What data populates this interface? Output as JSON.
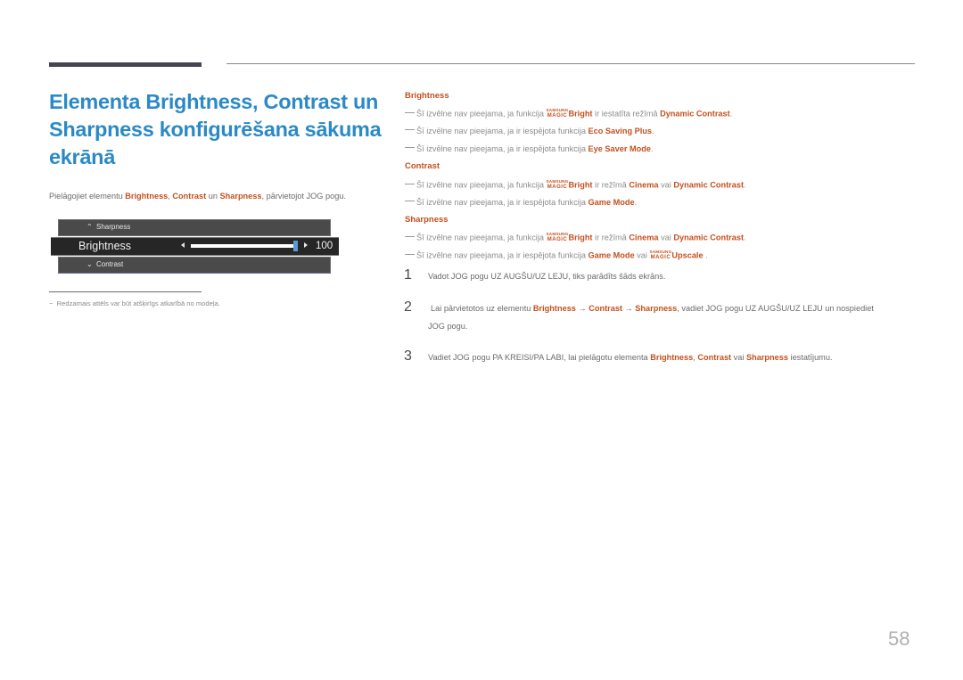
{
  "page": {
    "title": "Elementa Brightness, Contrast un Sharpness konfigurēšana sākuma ekrānā",
    "page_number": "58"
  },
  "intro": {
    "pre": "Pielāgojiet elementu ",
    "b1": "Brightness",
    "sep1": ", ",
    "b2": "Contrast",
    "sep2": " un ",
    "b3": "Sharpness",
    "post": ", pārvietojot JOG pogu."
  },
  "osd": {
    "up_item": "Sharpness",
    "current_item": "Brightness",
    "down_item": "Contrast",
    "value": "100",
    "level_percent": 100,
    "up_chevron_icon": "^",
    "down_chevron_icon": "⌄"
  },
  "footnote": {
    "dash": "−",
    "text": "Redzamais attēls var būt atšķirīgs atkarībā no modeļa."
  },
  "magic_logo": {
    "line1": "SAMSUNG",
    "line2": "MAGIC"
  },
  "sections": {
    "brightness": {
      "heading": "Brightness",
      "notes": [
        {
          "pre": "Šī izvēlne nav pieejama, ja funkcija ",
          "magic": "Bright",
          "mid": " ir iestatīta režīmā ",
          "hl": "Dynamic Contrast",
          "post": "."
        },
        {
          "pre": "Šī izvēlne nav pieejama, ja ir iespējota funkcija ",
          "hl": "Eco Saving Plus",
          "post": "."
        },
        {
          "pre": "Šī izvēlne nav pieejama, ja ir iespējota funkcija ",
          "hl": "Eye Saver Mode",
          "post": "."
        }
      ]
    },
    "contrast": {
      "heading": "Contrast",
      "notes": [
        {
          "pre": "Šī izvēlne nav pieejama, ja funkcija ",
          "magic": "Bright",
          "mid": " ir režīmā ",
          "hl": "Cinema",
          "mid2": " vai ",
          "hl2": "Dynamic Contrast",
          "post": "."
        },
        {
          "pre": "Šī izvēlne nav pieejama, ja ir iespējota funkcija ",
          "hl": "Game Mode",
          "post": "."
        }
      ]
    },
    "sharpness": {
      "heading": "Sharpness",
      "notes": [
        {
          "pre": "Šī izvēlne nav pieejama, ja funkcija ",
          "magic": "Bright",
          "mid": " ir režīmā ",
          "hl": "Cinema",
          "mid2": " vai ",
          "hl2": "Dynamic Contrast",
          "post": "."
        },
        {
          "pre": "Šī izvēlne nav pieejama, ja ir iespējota funkcija ",
          "hl": "Game Mode",
          "mid": " vai ",
          "magic": "Upscale",
          "post": " ."
        }
      ]
    }
  },
  "steps": [
    {
      "num": "1",
      "text": "Vadot JOG pogu UZ AUGŠU/UZ LEJU, tiks parādīts šāds ekrāns."
    },
    {
      "num": "2",
      "pre": "Lai pārvietotos uz elementu ",
      "b1": "Brightness",
      "arrow1": " → ",
      "b2": "Contrast",
      "arrow2": " → ",
      "b3": "Sharpness",
      "post": ", vadiet JOG pogu UZ AUGŠU/UZ LEJU un nospiediet",
      "line2": "JOG pogu."
    },
    {
      "num": "3",
      "pre": "Vadiet JOG pogu PA KREISI/PA LABI, lai pielāgotu elementa ",
      "b1": "Brightness",
      "sep1": ", ",
      "b2": "Contrast",
      "sep2": " vai ",
      "b3": "Sharpness",
      "post": " iestatījumu."
    }
  ],
  "colors": {
    "title_blue": "#2b8ac6",
    "highlight_orange": "#c5501e",
    "slider_thumb": "#5b9bd5"
  }
}
